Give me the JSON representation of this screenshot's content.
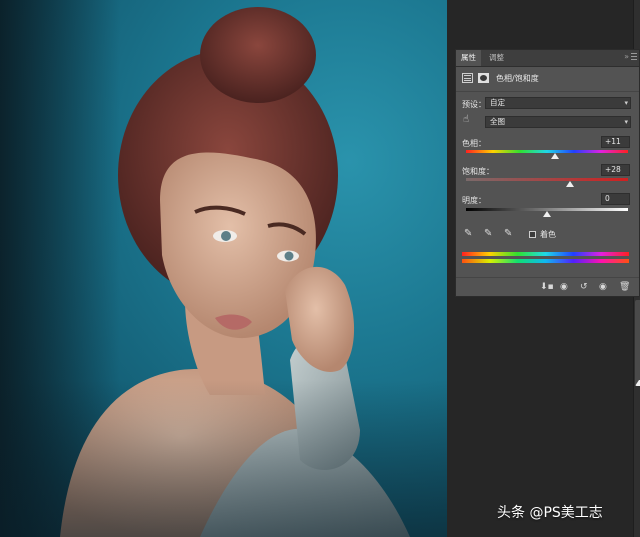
{
  "panel": {
    "tabs": [
      {
        "label": "属性",
        "active": true
      },
      {
        "label": "调整",
        "active": false
      }
    ],
    "collapse_icon": "double-chevron-right-icon",
    "menu_icon": "panel-menu-icon",
    "title": "色相/饱和度",
    "preset": {
      "label": "预设：",
      "value": "自定"
    },
    "channel": {
      "value": "全图"
    },
    "sliders": [
      {
        "label": "色相：",
        "value": "+11",
        "fraction": 0.55
      },
      {
        "label": "饱和度：",
        "value": "+28",
        "fraction": 0.64
      },
      {
        "label": "明度：",
        "value": "0",
        "fraction": 0.5
      }
    ],
    "colorize": {
      "label": "着色",
      "checked": false
    },
    "footer_icons": [
      "clip-to-layer-icon",
      "view-previous-icon",
      "reset-icon",
      "visibility-eye-icon",
      "trash-icon"
    ]
  },
  "watermark": "头条 @PS美工志",
  "colors": {
    "panel_bg": "#535353",
    "app_bg": "#262626",
    "backdrop_teal": "#1c7891",
    "hair": "#7a3b34",
    "skin": "#d4a88e",
    "sweater": "#a9b6b8"
  }
}
